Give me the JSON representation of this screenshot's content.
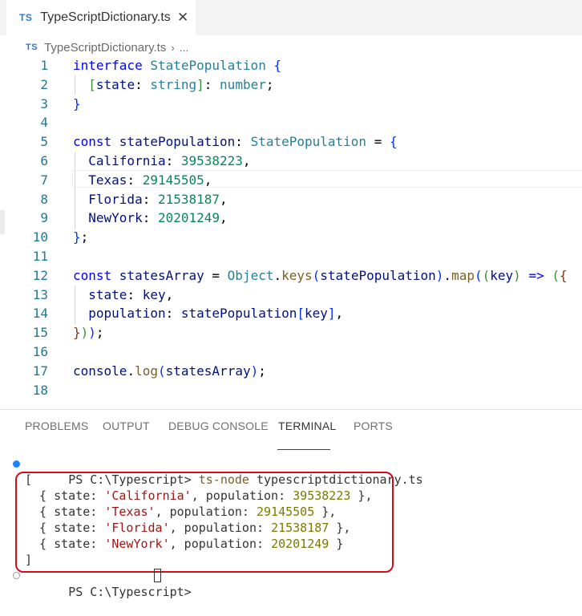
{
  "tab": {
    "badge": "TS",
    "title": "TypeScriptDictionary.ts",
    "close": "✕"
  },
  "breadcrumb": {
    "badge": "TS",
    "file": "TypeScriptDictionary.ts",
    "sep": "›",
    "more": "..."
  },
  "code_lines": [
    [
      {
        "t": "interface ",
        "c": "kw"
      },
      {
        "t": "StatePopulation",
        "c": "ty"
      },
      {
        "t": " ",
        "c": "pu"
      },
      {
        "t": "{",
        "c": "b1"
      }
    ],
    [
      {
        "t": "  ",
        "c": "pu"
      },
      {
        "t": "[",
        "c": "b2"
      },
      {
        "t": "state",
        "c": "pr"
      },
      {
        "t": ": ",
        "c": "pu"
      },
      {
        "t": "string",
        "c": "ty"
      },
      {
        "t": "]",
        "c": "b2"
      },
      {
        "t": ": ",
        "c": "pu"
      },
      {
        "t": "number",
        "c": "ty"
      },
      {
        "t": ";",
        "c": "pu"
      }
    ],
    [
      {
        "t": "}",
        "c": "b1"
      }
    ],
    [],
    [
      {
        "t": "const ",
        "c": "kw"
      },
      {
        "t": "statePopulation",
        "c": "pr"
      },
      {
        "t": ": ",
        "c": "pu"
      },
      {
        "t": "StatePopulation",
        "c": "ty"
      },
      {
        "t": " = ",
        "c": "pu"
      },
      {
        "t": "{",
        "c": "b1"
      }
    ],
    [
      {
        "t": "  ",
        "c": "pu"
      },
      {
        "t": "California",
        "c": "pr"
      },
      {
        "t": ": ",
        "c": "pu"
      },
      {
        "t": "39538223",
        "c": "nu"
      },
      {
        "t": ",",
        "c": "pu"
      }
    ],
    [
      {
        "t": "  ",
        "c": "pu"
      },
      {
        "t": "Texas",
        "c": "pr"
      },
      {
        "t": ": ",
        "c": "pu"
      },
      {
        "t": "29145505",
        "c": "nu"
      },
      {
        "t": ",",
        "c": "pu"
      }
    ],
    [
      {
        "t": "  ",
        "c": "pu"
      },
      {
        "t": "Florida",
        "c": "pr"
      },
      {
        "t": ": ",
        "c": "pu"
      },
      {
        "t": "21538187",
        "c": "nu"
      },
      {
        "t": ",",
        "c": "pu"
      }
    ],
    [
      {
        "t": "  ",
        "c": "pu"
      },
      {
        "t": "NewYork",
        "c": "pr"
      },
      {
        "t": ": ",
        "c": "pu"
      },
      {
        "t": "20201249",
        "c": "nu"
      },
      {
        "t": ",",
        "c": "pu"
      }
    ],
    [
      {
        "t": "}",
        "c": "b1"
      },
      {
        "t": ";",
        "c": "pu"
      }
    ],
    [],
    [
      {
        "t": "const ",
        "c": "kw"
      },
      {
        "t": "statesArray",
        "c": "pr"
      },
      {
        "t": " = ",
        "c": "pu"
      },
      {
        "t": "Object",
        "c": "ty"
      },
      {
        "t": ".",
        "c": "pu"
      },
      {
        "t": "keys",
        "c": "fn"
      },
      {
        "t": "(",
        "c": "b1"
      },
      {
        "t": "statePopulation",
        "c": "pr"
      },
      {
        "t": ")",
        "c": "b1"
      },
      {
        "t": ".",
        "c": "pu"
      },
      {
        "t": "map",
        "c": "fn"
      },
      {
        "t": "(",
        "c": "b1"
      },
      {
        "t": "(",
        "c": "b2"
      },
      {
        "t": "key",
        "c": "pr"
      },
      {
        "t": ")",
        "c": "b2"
      },
      {
        "t": " ",
        "c": "pu"
      },
      {
        "t": "=>",
        "c": "kw"
      },
      {
        "t": " ",
        "c": "pu"
      },
      {
        "t": "(",
        "c": "b2"
      },
      {
        "t": "{",
        "c": "b3"
      }
    ],
    [
      {
        "t": "  ",
        "c": "pu"
      },
      {
        "t": "state",
        "c": "pr"
      },
      {
        "t": ": ",
        "c": "pu"
      },
      {
        "t": "key",
        "c": "pr"
      },
      {
        "t": ",",
        "c": "pu"
      }
    ],
    [
      {
        "t": "  ",
        "c": "pu"
      },
      {
        "t": "population",
        "c": "pr"
      },
      {
        "t": ": ",
        "c": "pu"
      },
      {
        "t": "statePopulation",
        "c": "pr"
      },
      {
        "t": "[",
        "c": "b1"
      },
      {
        "t": "key",
        "c": "pr"
      },
      {
        "t": "]",
        "c": "b1"
      },
      {
        "t": ",",
        "c": "pu"
      }
    ],
    [
      {
        "t": "}",
        "c": "b3"
      },
      {
        "t": ")",
        "c": "b2"
      },
      {
        "t": ")",
        "c": "b1"
      },
      {
        "t": ";",
        "c": "pu"
      }
    ],
    [],
    [
      {
        "t": "console",
        "c": "pr"
      },
      {
        "t": ".",
        "c": "pu"
      },
      {
        "t": "log",
        "c": "fn"
      },
      {
        "t": "(",
        "c": "b1"
      },
      {
        "t": "statesArray",
        "c": "pr"
      },
      {
        "t": ")",
        "c": "b1"
      },
      {
        "t": ";",
        "c": "pu"
      }
    ],
    []
  ],
  "line_numbers": [
    "1",
    "2",
    "3",
    "4",
    "5",
    "6",
    "7",
    "8",
    "9",
    "10",
    "11",
    "12",
    "13",
    "14",
    "15",
    "16",
    "17",
    "18"
  ],
  "panel": {
    "tabs": [
      "PROBLEMS",
      "OUTPUT",
      "DEBUG CONSOLE",
      "TERMINAL",
      "PORTS"
    ],
    "active_tab": "TERMINAL"
  },
  "terminal": {
    "prompt": "PS C:\\Typescript>",
    "command": "ts-node",
    "argument": "typescriptdictionary.ts",
    "open_bracket": "[",
    "close_bracket": "]",
    "rows": [
      {
        "state": "'California'",
        "population": "39538223"
      },
      {
        "state": "'Texas'",
        "population": "29145505"
      },
      {
        "state": "'Florida'",
        "population": "21538187"
      },
      {
        "state": "'NewYork'",
        "population": "20201249"
      }
    ],
    "row_labels": {
      "open": "{ state: ",
      "mid": ", population: ",
      "close": " }",
      "comma": ","
    }
  },
  "colors": {
    "accent_dot": "#1a85ff",
    "highlight_box": "#d10d19"
  }
}
